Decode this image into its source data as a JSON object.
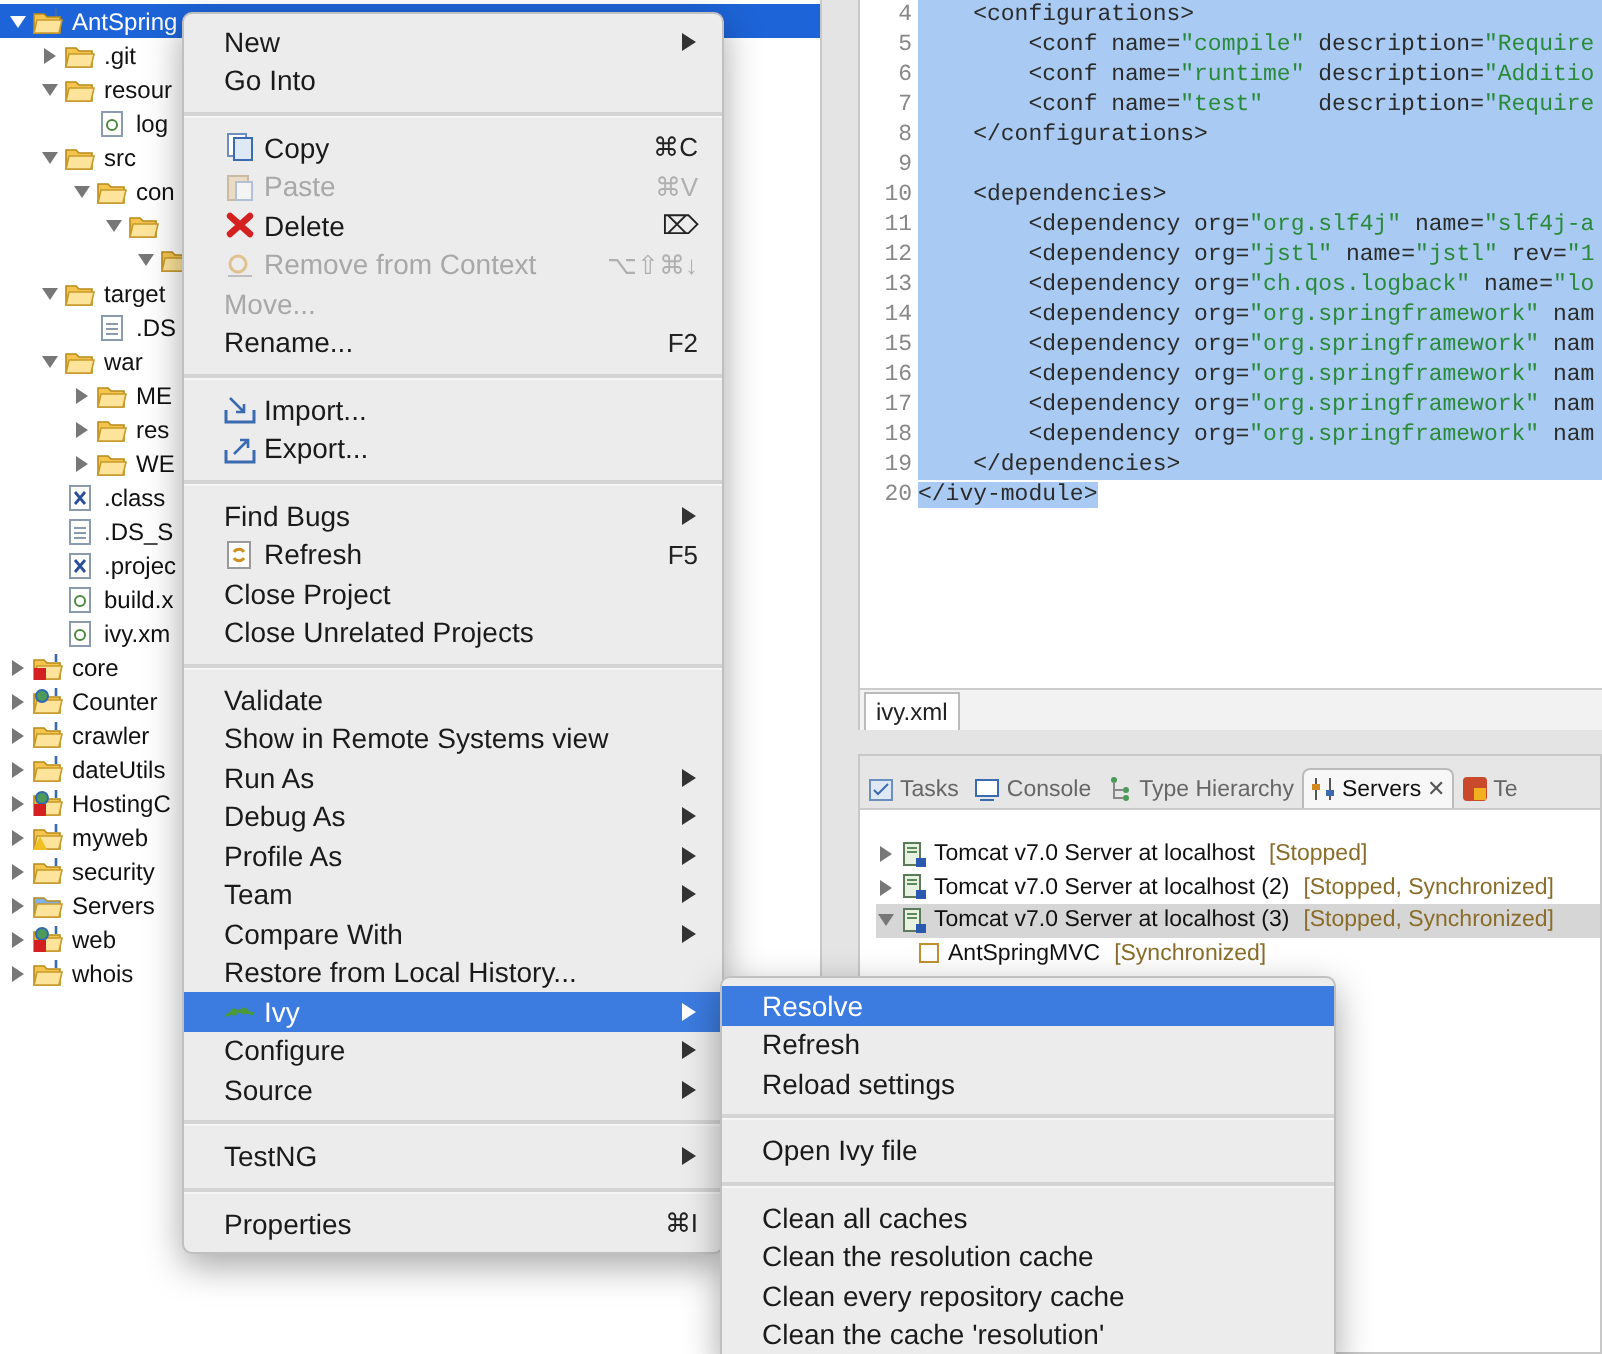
{
  "project_tree": {
    "items": [
      {
        "label": "AntSpring",
        "kind": "project",
        "expanded": true,
        "selected": true,
        "children": [
          {
            "label": ".git",
            "kind": "folder",
            "expanded": false,
            "selected": false
          },
          {
            "label": "resour",
            "kind": "folder",
            "expanded": true,
            "selected": false,
            "children": [
              {
                "label": "log",
                "kind": "ant",
                "selected": false
              }
            ]
          },
          {
            "label": "src",
            "kind": "folder",
            "expanded": true,
            "selected": false,
            "children": [
              {
                "label": "con",
                "kind": "folder",
                "expanded": true,
                "selected": false,
                "children": [
                  {
                    "kind": "folder",
                    "expanded": true,
                    "selected": false,
                    "children": [
                      {
                        "kind": "folder",
                        "expanded": true,
                        "selected": false
                      }
                    ]
                  }
                ]
              }
            ]
          },
          {
            "label": "target",
            "kind": "folder",
            "expanded": true,
            "selected": false,
            "children": [
              {
                "label": ".DS",
                "kind": "file",
                "selected": false
              }
            ]
          },
          {
            "label": "war",
            "kind": "folder",
            "expanded": true,
            "selected": false,
            "children": [
              {
                "label": "ME",
                "kind": "folder",
                "expanded": false,
                "selected": false
              },
              {
                "label": "res",
                "kind": "folder",
                "expanded": false,
                "selected": false
              },
              {
                "label": "WE",
                "kind": "folder",
                "expanded": false,
                "selected": false
              }
            ]
          },
          {
            "label": ".class",
            "kind": "xml",
            "selected": false
          },
          {
            "label": ".DS_S",
            "kind": "file",
            "selected": false
          },
          {
            "label": ".projec",
            "kind": "xml",
            "selected": false
          },
          {
            "label": "build.x",
            "kind": "ant",
            "selected": false
          },
          {
            "label": "ivy.xm",
            "kind": "ant",
            "selected": false
          }
        ]
      },
      {
        "label": "core",
        "kind": "project-error",
        "expanded": false,
        "selected": false
      },
      {
        "label": "Counter",
        "kind": "project-web",
        "expanded": false,
        "selected": false
      },
      {
        "label": "crawler",
        "kind": "project",
        "expanded": false,
        "selected": false
      },
      {
        "label": "dateUtils",
        "kind": "project",
        "expanded": false,
        "selected": false
      },
      {
        "label": "HostingC",
        "kind": "project-web-error",
        "expanded": false,
        "selected": false
      },
      {
        "label": "myweb",
        "kind": "project-warning",
        "expanded": false,
        "selected": false
      },
      {
        "label": "security",
        "kind": "project",
        "expanded": false,
        "selected": false
      },
      {
        "label": "Servers",
        "kind": "folder-blue",
        "expanded": false,
        "selected": false
      },
      {
        "label": "web",
        "kind": "project-web-error",
        "expanded": false,
        "selected": false
      },
      {
        "label": "whois",
        "kind": "project",
        "expanded": false,
        "selected": false
      }
    ]
  },
  "editor": {
    "tab": "ivy.xml",
    "lines": [
      {
        "number": "4",
        "text": "    <configurations>",
        "selected": true
      },
      {
        "number": "5",
        "text": "        <conf name=\"compile\" description=\"Require",
        "selected": true
      },
      {
        "number": "6",
        "text": "        <conf name=\"runtime\" description=\"Additio",
        "selected": true
      },
      {
        "number": "7",
        "text": "        <conf name=\"test\"    description=\"Require",
        "selected": true
      },
      {
        "number": "8",
        "text": "    </configurations>",
        "selected": true
      },
      {
        "number": "9",
        "selected": true
      },
      {
        "number": "10",
        "text": "    <dependencies>",
        "selected": true
      },
      {
        "number": "11",
        "text": "        <dependency org=\"org.slf4j\" name=\"slf4j-a",
        "selected": true
      },
      {
        "number": "12",
        "text": "        <dependency org=\"jstl\" name=\"jstl\" rev=\"1",
        "selected": true
      },
      {
        "number": "13",
        "text": "        <dependency org=\"ch.qos.logback\" name=\"lo",
        "selected": true
      },
      {
        "number": "14",
        "text": "        <dependency org=\"org.springframework\" nam",
        "selected": true
      },
      {
        "number": "15",
        "text": "        <dependency org=\"org.springframework\" nam",
        "selected": true
      },
      {
        "number": "16",
        "text": "        <dependency org=\"org.springframework\" nam",
        "selected": true
      },
      {
        "number": "17",
        "text": "        <dependency org=\"org.springframework\" nam",
        "selected": true
      },
      {
        "number": "18",
        "text": "        <dependency org=\"org.springframework\" nam",
        "selected": true
      },
      {
        "number": "19",
        "text": "    </dependencies>",
        "selected": true
      },
      {
        "number": "20",
        "text": "</ivy-module>",
        "selected": true
      }
    ]
  },
  "bottom_panel": {
    "tabs": [
      {
        "label": "Tasks",
        "kind": "tasks",
        "selected": false
      },
      {
        "label": "Console",
        "kind": "console",
        "selected": false
      },
      {
        "label": "Type Hierarchy",
        "kind": "hierarchy",
        "selected": false
      },
      {
        "label": "Servers",
        "kind": "servers",
        "selected": true,
        "close": "✕"
      },
      {
        "label": "Te",
        "kind": "testng",
        "selected": false
      }
    ],
    "servers": [
      {
        "name": "Tomcat v7.0 Server at localhost",
        "status": "[Stopped]",
        "expanded": false,
        "selected": false
      },
      {
        "name": "Tomcat v7.0 Server at localhost (2)",
        "status": "[Stopped, Synchronized]",
        "expanded": false,
        "selected": false
      },
      {
        "name": "Tomcat v7.0 Server at localhost (3)",
        "status": "[Stopped, Synchronized]",
        "expanded": true,
        "selected": true,
        "children": [
          {
            "name": "AntSpringMVC",
            "status": "[Synchronized]"
          }
        ]
      }
    ]
  },
  "context_menu": {
    "groups": [
      [
        {
          "label": "New",
          "submenu": true,
          "selected": false
        },
        {
          "label": "Go Into",
          "selected": false
        }
      ],
      [
        {
          "label": "Copy",
          "kind": "copy",
          "shortcut": "⌘C",
          "selected": false
        },
        {
          "label": "Paste",
          "kind": "paste",
          "shortcut": "⌘V",
          "disabled": true,
          "selected": false
        },
        {
          "label": "Delete",
          "kind": "delete",
          "shortcut": "⌦",
          "selected": false
        },
        {
          "label": "Remove from Context",
          "kind": "context",
          "shortcut": "⌥⇧⌘↓",
          "disabled": true,
          "selected": false
        },
        {
          "label": "Move...",
          "disabled": true,
          "selected": false
        },
        {
          "label": "Rename...",
          "shortcut": "F2",
          "selected": false
        }
      ],
      [
        {
          "label": "Import...",
          "kind": "import",
          "selected": false
        },
        {
          "label": "Export...",
          "kind": "export",
          "selected": false
        }
      ],
      [
        {
          "label": "Find Bugs",
          "submenu": true,
          "selected": false
        },
        {
          "label": "Refresh",
          "kind": "refresh",
          "shortcut": "F5",
          "selected": false
        },
        {
          "label": "Close Project",
          "selected": false
        },
        {
          "label": "Close Unrelated Projects",
          "selected": false
        }
      ],
      [
        {
          "label": "Validate",
          "selected": false
        },
        {
          "label": "Show in Remote Systems view",
          "selected": false
        },
        {
          "label": "Run As",
          "submenu": true,
          "selected": false
        },
        {
          "label": "Debug As",
          "submenu": true,
          "selected": false
        },
        {
          "label": "Profile As",
          "submenu": true,
          "selected": false
        },
        {
          "label": "Team",
          "submenu": true,
          "selected": false
        },
        {
          "label": "Compare With",
          "submenu": true,
          "selected": false
        },
        {
          "label": "Restore from Local History...",
          "selected": false
        },
        {
          "label": "Ivy",
          "kind": "ivy",
          "submenu": true,
          "selected": true
        },
        {
          "label": "Configure",
          "submenu": true,
          "selected": false
        },
        {
          "label": "Source",
          "submenu": true,
          "selected": false
        }
      ],
      [
        {
          "label": "TestNG",
          "submenu": true,
          "selected": false
        }
      ],
      [
        {
          "label": "Properties",
          "shortcut": "⌘I",
          "selected": false
        }
      ]
    ]
  },
  "ivy_submenu": {
    "groups": [
      [
        {
          "label": "Resolve",
          "selected": true
        },
        {
          "label": "Refresh",
          "selected": false
        },
        {
          "label": "Reload settings",
          "selected": false
        }
      ],
      [
        {
          "label": "Open Ivy file",
          "selected": false
        }
      ],
      [
        {
          "label": "Clean all caches",
          "selected": false
        },
        {
          "label": "Clean the resolution cache",
          "selected": false
        },
        {
          "label": "Clean every repository cache",
          "selected": false
        },
        {
          "label": "Clean the cache 'resolution'",
          "selected": false
        }
      ]
    ]
  }
}
